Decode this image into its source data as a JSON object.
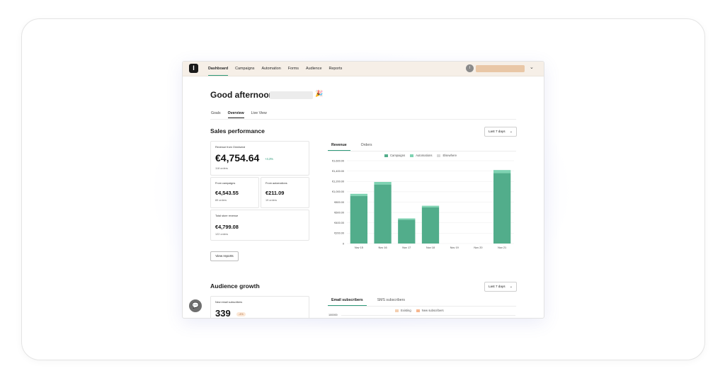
{
  "nav": {
    "logo": "I",
    "items": [
      {
        "label": "Dashboard",
        "active": true
      },
      {
        "label": "Campaigns",
        "active": false
      },
      {
        "label": "Automation",
        "active": false
      },
      {
        "label": "Forms",
        "active": false
      },
      {
        "label": "Audience",
        "active": false
      },
      {
        "label": "Reports",
        "active": false
      }
    ],
    "avatar_initial": "I",
    "chevron": "⌄"
  },
  "greeting": {
    "text": "Good afternoon,",
    "icon": "party-popper-icon",
    "icon_glyph": "🎉"
  },
  "page_tabs": [
    {
      "label": "Goals",
      "active": false
    },
    {
      "label": "Overview",
      "active": true
    },
    {
      "label": "Live View",
      "active": false
    }
  ],
  "sales": {
    "title": "Sales performance",
    "range": "Last 7 days",
    "revenue_card": {
      "label": "Revenue from Omnisend",
      "value": "€4,754.64",
      "delta": "+4.3%",
      "orders": "118 orders"
    },
    "campaigns_card": {
      "label": "From campaigns",
      "value": "€4,543.55",
      "orders": "89 orders"
    },
    "automations_card": {
      "label": "From automations",
      "value": "€211.09",
      "orders": "19 orders"
    },
    "total_card": {
      "label": "Total store revenue",
      "value": "€4,799.08",
      "orders": "122 orders"
    },
    "view_reports": "View reports"
  },
  "sales_chart_tabs": [
    {
      "label": "Revenue",
      "active": true
    },
    {
      "label": "Orders",
      "active": false
    }
  ],
  "chart_data": {
    "type": "bar",
    "stacked": true,
    "categories": [
      "Nov 15",
      "Nov 16",
      "Nov 17",
      "Nov 18",
      "Nov 19",
      "Nov 20",
      "Nov 21"
    ],
    "series": [
      {
        "name": "Campaigns",
        "color": "#52ad8b",
        "values": [
          920,
          1140,
          460,
          700,
          0,
          0,
          1360
        ]
      },
      {
        "name": "Automations",
        "color": "#7ed3b2",
        "values": [
          40,
          50,
          25,
          30,
          0,
          0,
          60
        ]
      },
      {
        "name": "Elsewhere",
        "color": "#d9d9d9",
        "values": [
          0,
          0,
          0,
          0,
          0,
          0,
          0
        ]
      }
    ],
    "y_ticks": [
      "0",
      "€200.00",
      "€400.00",
      "€600.00",
      "€800.00",
      "€1,000.00",
      "€1,200.00",
      "€1,400.00",
      "€1,600.00"
    ],
    "ylim": [
      0,
      1600
    ],
    "grid": true,
    "legend": "top-center"
  },
  "audience": {
    "title": "Audience growth",
    "range": "Last 7 days",
    "new_card": {
      "label": "New email subscribers",
      "value": "339",
      "badge": "-4%"
    },
    "tabs": [
      {
        "label": "Email subscribers",
        "active": true
      },
      {
        "label": "SMS subscribers",
        "active": false
      }
    ],
    "legend": [
      {
        "name": "Existing",
        "color": "#f3cfb1"
      },
      {
        "name": "New subscribers",
        "color": "#f6b68e"
      }
    ],
    "y_top_tick": "100000"
  },
  "chat_icon": "💬"
}
